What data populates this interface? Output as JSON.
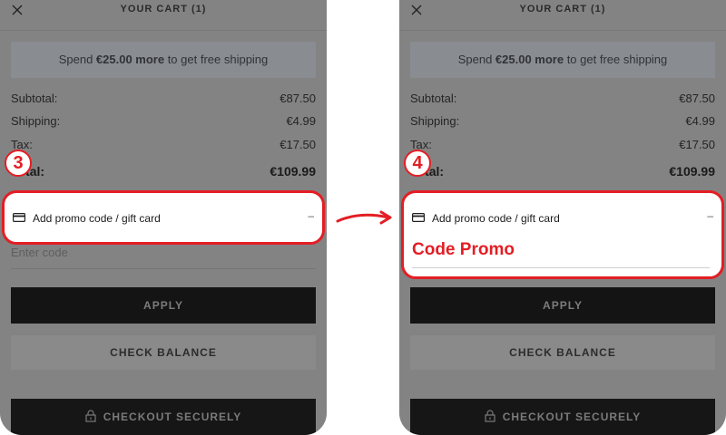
{
  "cart": {
    "title": "YOUR CART (1)",
    "shipping_banner": {
      "prefix": "Spend ",
      "amount": "€25.00 more",
      "suffix": " to get free shipping"
    },
    "subtotal": {
      "label": "Subtotal:",
      "value": "€87.50"
    },
    "shipping": {
      "label": "Shipping:",
      "value": "€4.99"
    },
    "tax": {
      "label": "Tax:",
      "value": "€17.50"
    },
    "total": {
      "label": "Total:",
      "value": "€109.99"
    },
    "promo": {
      "label": "Add promo code / gift card",
      "toggle": "–"
    },
    "code_input_placeholder": "Enter code",
    "apply_label": "APPLY",
    "check_balance_label": "CHECK BALANCE",
    "checkout_label": "CHECKOUT SECURELY"
  },
  "annotations": {
    "step_left": "3",
    "step_right": "4",
    "promo_callout": "Code Promo",
    "accent_color": "#e31e24"
  },
  "icons": [
    "close-icon",
    "credit-card-icon",
    "lock-icon",
    "arrow-right-icon"
  ]
}
